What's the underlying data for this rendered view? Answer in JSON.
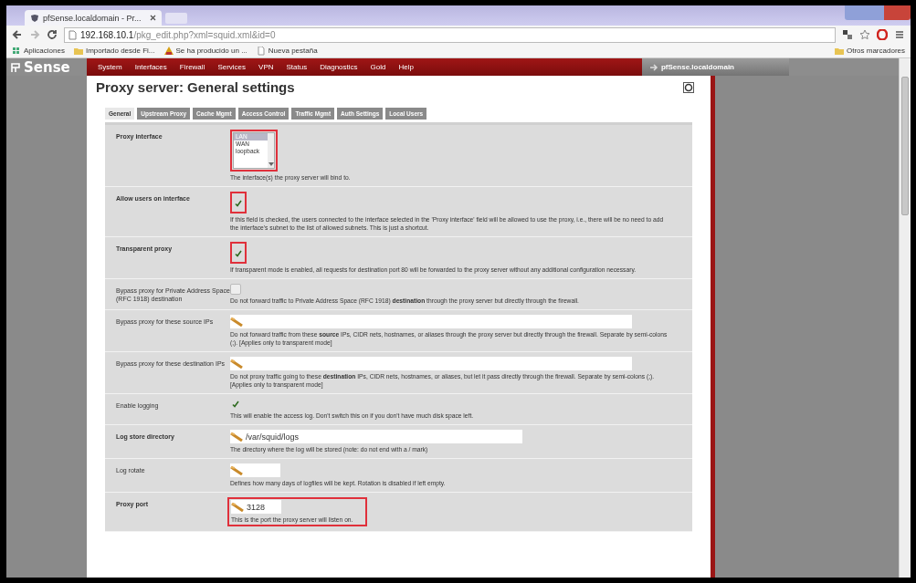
{
  "browser": {
    "tab_title": "pfSense.localdomain - Pr...",
    "url_host": "192.168.10.1",
    "url_path": "/pkg_edit.php?xml=squid.xml&id=0",
    "bookmarks": [
      {
        "label": "Aplicaciones",
        "kind": "apps"
      },
      {
        "label": "Importado desde Fi...",
        "kind": "folder"
      },
      {
        "label": "Se ha producido un ...",
        "kind": "warning"
      },
      {
        "label": "Nueva pestaña",
        "kind": "page"
      }
    ],
    "other_bookmarks": "Otros marcadores"
  },
  "header": {
    "logo": "Sense",
    "menu": [
      "System",
      "Interfaces",
      "Firewall",
      "Services",
      "VPN",
      "Status",
      "Diagnostics",
      "Gold",
      "Help"
    ],
    "hostname": "pfSense.localdomain"
  },
  "page": {
    "title": "Proxy server: General settings",
    "tabs": [
      {
        "label": "General",
        "selected": true
      },
      {
        "label": "Upstream Proxy",
        "selected": false
      },
      {
        "label": "Cache Mgmt",
        "selected": false
      },
      {
        "label": "Access Control",
        "selected": false
      },
      {
        "label": "Traffic Mgmt",
        "selected": false
      },
      {
        "label": "Auth Settings",
        "selected": false
      },
      {
        "label": "Local Users",
        "selected": false
      }
    ],
    "rows": [
      {
        "label": "Proxy interface",
        "bold": true,
        "kind": "select",
        "highlighted": true,
        "options": [
          {
            "label": "LAN",
            "selected": true
          },
          {
            "label": "WAN",
            "selected": false
          },
          {
            "label": "loopback",
            "selected": false
          }
        ],
        "description": "The interface(s) the proxy server will bind to."
      },
      {
        "label": "Allow users on interface",
        "bold": true,
        "kind": "checkbox",
        "highlighted": true,
        "checked": true,
        "description": "If this field is checked, the users connected to the interface selected in the 'Proxy interface' field will be allowed to use the proxy, i.e., there will be no need to add the interface's subnet to the list of allowed subnets. This is just a shortcut."
      },
      {
        "label": "Transparent proxy",
        "bold": true,
        "kind": "checkbox",
        "highlighted": true,
        "checked": true,
        "description": "If transparent mode is enabled, all requests for destination port 80 will be forwarded to the proxy server without any additional configuration necessary."
      },
      {
        "label": "Bypass proxy for Private Address Space (RFC 1918) destination",
        "bold": false,
        "kind": "checkbox",
        "checked": false,
        "description": "Do not forward traffic to Private Address Space (RFC 1918) **destination** through the proxy server but directly through the firewall."
      },
      {
        "label": "Bypass proxy for these source IPs",
        "bold": false,
        "kind": "text_long",
        "description": "Do not forward traffic from these **source** IPs, CIDR nets, hostnames, or aliases through the proxy server but directly through the firewall. Separate by semi-colons (;). [Applies only to transparent mode]"
      },
      {
        "label": "Bypass proxy for these destination IPs",
        "bold": false,
        "kind": "text_long",
        "description": "Do not proxy traffic going to these **destination** IPs, CIDR nets, hostnames, or aliases, but let it pass directly through the firewall. Separate by semi-colons (;). [Applies only to transparent mode]"
      },
      {
        "label": "Enable logging",
        "bold": false,
        "kind": "checkbox",
        "checked": true,
        "description": "This will enable the access log. Don't switch this on if you don't have much disk space left."
      },
      {
        "label": "Log store directory",
        "bold": true,
        "kind": "text_medium",
        "value": "/var/squid/logs",
        "description": "The directory where the log will be stored (note: do not end with a / mark)"
      },
      {
        "label": "Log rotate",
        "bold": false,
        "kind": "text_short",
        "description": "Defines how many days of logfiles will be kept. Rotation is disabled if left empty."
      },
      {
        "label": "Proxy port",
        "bold": true,
        "kind": "text_short",
        "highlighted": true,
        "value": "3128",
        "description": "This is the port the proxy server will listen on."
      }
    ]
  }
}
